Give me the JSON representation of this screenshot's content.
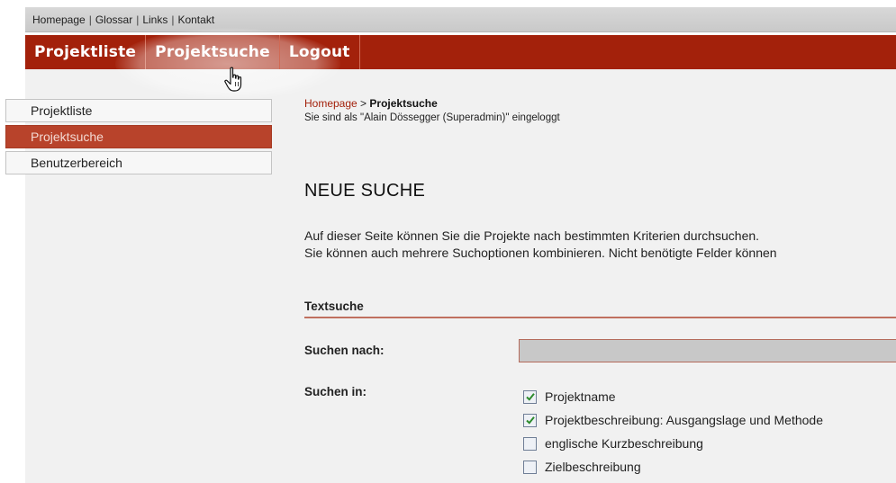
{
  "topnav": {
    "links": [
      "Homepage",
      "Glossar",
      "Links",
      "Kontakt"
    ],
    "separator": "|"
  },
  "mainnav": {
    "tabs": [
      "Projektliste",
      "Projektsuche",
      "Logout"
    ],
    "active": "Projektsuche"
  },
  "sidebar": {
    "items": [
      "Projektliste",
      "Projektsuche",
      "Benutzerbereich"
    ],
    "active": "Projektsuche"
  },
  "breadcrumb": {
    "home": "Homepage",
    "sep": " > ",
    "current": "Projektsuche"
  },
  "login_status": "Sie sind als \"Alain Dössegger (Superadmin)\" eingeloggt",
  "page_title": "NEUE SUCHE",
  "intro": {
    "line1": "Auf dieser Seite können Sie die Projekte nach bestimmten Kriterien durchsuchen.",
    "line2": "Sie können auch mehrere Suchoptionen kombinieren. Nicht benötigte Felder können"
  },
  "section": {
    "title": "Textsuche",
    "search_for_label": "Suchen nach:",
    "search_value": "",
    "search_in_label": "Suchen in:",
    "options": [
      {
        "label": "Projektname",
        "checked": true
      },
      {
        "label": "Projektbeschreibung: Ausgangslage und Methode",
        "checked": true
      },
      {
        "label": "englische Kurzbeschreibung",
        "checked": false
      },
      {
        "label": "Zielbeschreibung",
        "checked": false
      }
    ]
  },
  "colors": {
    "brand_red": "#a3210b",
    "sidebar_active": "#b8432b"
  }
}
